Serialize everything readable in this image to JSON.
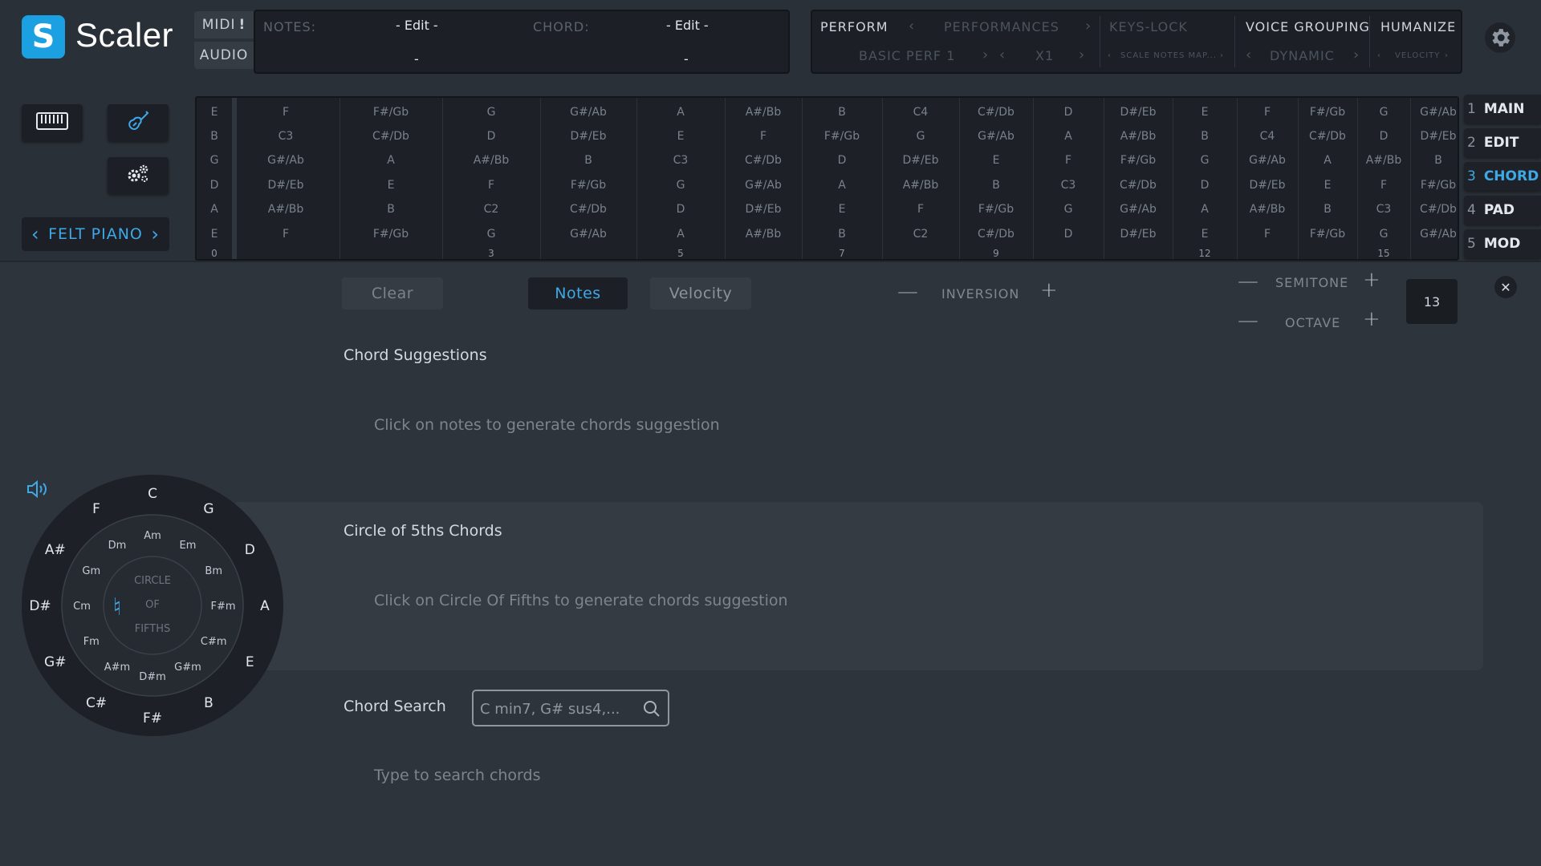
{
  "app": {
    "title": "Scaler",
    "logo_glyph": "S"
  },
  "io": {
    "midi": "MIDI",
    "midi_flag": "!",
    "audio": "AUDIO"
  },
  "notes_box": {
    "notes_label": "NOTES:",
    "notes_value": "- Edit -",
    "chord_label": "CHORD:",
    "chord_value": "- Edit -",
    "notes_sub": "-",
    "chord_sub": "-"
  },
  "perform": {
    "perform": "PERFORM",
    "performances": "PERFORMANCES",
    "basic_perf": "BASIC PERF 1",
    "x1": "X1",
    "keys_lock": "KEYS-LOCK",
    "scale_notes_map": "SCALE NOTES MAP...",
    "voice_grouping": "VOICE GROUPING",
    "dynamic": "DYNAMIC",
    "humanize": "HUMANIZE",
    "velocity": "VELOCITY",
    "arrow_left": "‹",
    "arrow_right": "›"
  },
  "preset": {
    "name": "FELT PIANO",
    "prev": "‹",
    "next": "›"
  },
  "tools": {
    "keyboard_icon": "keyboard-icon",
    "guitar_icon": "guitar-icon",
    "settings_icon": "gears-icon"
  },
  "grid": {
    "columns": [
      {
        "notes": [
          "E",
          "B",
          "G",
          "D",
          "A",
          "E"
        ],
        "num": "0"
      },
      {
        "notes": [
          "F",
          "C3",
          "G#/Ab",
          "D#/Eb",
          "A#/Bb",
          "F"
        ],
        "num": ""
      },
      {
        "notes": [
          "F#/Gb",
          "C#/Db",
          "A",
          "E",
          "B",
          "F#/Gb"
        ],
        "num": ""
      },
      {
        "notes": [
          "G",
          "D",
          "A#/Bb",
          "F",
          "C2",
          "G"
        ],
        "num": "3"
      },
      {
        "notes": [
          "G#/Ab",
          "D#/Eb",
          "B",
          "F#/Gb",
          "C#/Db",
          "G#/Ab"
        ],
        "num": ""
      },
      {
        "notes": [
          "A",
          "E",
          "C3",
          "G",
          "D",
          "A"
        ],
        "num": "5"
      },
      {
        "notes": [
          "A#/Bb",
          "F",
          "C#/Db",
          "G#/Ab",
          "D#/Eb",
          "A#/Bb"
        ],
        "num": ""
      },
      {
        "notes": [
          "B",
          "F#/Gb",
          "D",
          "A",
          "E",
          "B"
        ],
        "num": "7"
      },
      {
        "notes": [
          "C4",
          "G",
          "D#/Eb",
          "A#/Bb",
          "F",
          "C2"
        ],
        "num": ""
      },
      {
        "notes": [
          "C#/Db",
          "G#/Ab",
          "E",
          "B",
          "F#/Gb",
          "C#/Db"
        ],
        "num": "9"
      },
      {
        "notes": [
          "D",
          "A",
          "F",
          "C3",
          "G",
          "D"
        ],
        "num": ""
      },
      {
        "notes": [
          "D#/Eb",
          "A#/Bb",
          "F#/Gb",
          "C#/Db",
          "G#/Ab",
          "D#/Eb"
        ],
        "num": ""
      },
      {
        "notes": [
          "E",
          "B",
          "G",
          "D",
          "A",
          "E"
        ],
        "num": "12"
      },
      {
        "notes": [
          "F",
          "C4",
          "G#/Ab",
          "D#/Eb",
          "A#/Bb",
          "F"
        ],
        "num": ""
      },
      {
        "notes": [
          "F#/Gb",
          "C#/Db",
          "A",
          "E",
          "B",
          "F#/Gb"
        ],
        "num": ""
      },
      {
        "notes": [
          "G",
          "D",
          "A#/Bb",
          "F",
          "C3",
          "G"
        ],
        "num": "15"
      },
      {
        "notes": [
          "G#/Ab",
          "D#/Eb",
          "B",
          "F#/Gb",
          "C#/Db",
          "G#/Ab"
        ],
        "num": ""
      }
    ]
  },
  "tabs": [
    {
      "num": "1",
      "label": "MAIN"
    },
    {
      "num": "2",
      "label": "EDIT"
    },
    {
      "num": "3",
      "label": "CHORD"
    },
    {
      "num": "4",
      "label": "PAD"
    },
    {
      "num": "5",
      "label": "MOD"
    }
  ],
  "active_tab": "CHORD",
  "controls": {
    "clear": "Clear",
    "notes": "Notes",
    "velocity": "Velocity",
    "inversion": "INVERSION",
    "semitone": "SEMITONE",
    "octave": "OCTAVE",
    "minus": "—",
    "plus": "+",
    "value": "13",
    "close": "✕"
  },
  "sections": {
    "suggestions_title": "Chord Suggestions",
    "suggestions_hint": "Click on notes to generate chords suggestion",
    "cof_title": "Circle of 5ths Chords",
    "cof_hint": "Click on Circle Of Fifths to generate chords suggestion",
    "search_title": "Chord Search",
    "search_placeholder": "C min7, G# sus4,...",
    "search_hint": "Type to search chords"
  },
  "circle_of_fifths": {
    "outer": [
      "C",
      "G",
      "D",
      "A",
      "E",
      "B",
      "F#",
      "C#",
      "G#",
      "D#",
      "A#",
      "F"
    ],
    "inner": [
      "Am",
      "Em",
      "Bm",
      "F#m",
      "C#m",
      "G#m",
      "D#m",
      "A#m",
      "Fm",
      "Cm",
      "Gm",
      "Dm"
    ],
    "center": [
      "CIRCLE",
      "OF",
      "FIFTHS"
    ],
    "natural_glyph": "♮",
    "speaker_icon": "speaker-icon"
  },
  "colors": {
    "accent": "#3fa8e6",
    "background": "#2e343c",
    "panel": "#1c2026"
  }
}
